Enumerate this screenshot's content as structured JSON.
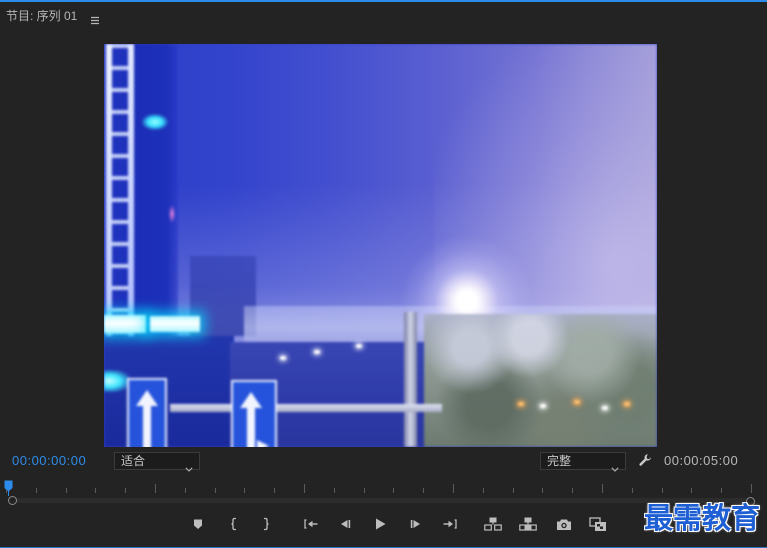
{
  "panel": {
    "title": "节目: 序列 01",
    "menu_icon": "hamburger-menu-icon"
  },
  "colors": {
    "accent": "#2d8ceb",
    "background": "#232323",
    "icon": "#bdbdbd",
    "watermark": "#1f5fd4"
  },
  "timecode_bar": {
    "current_timecode": "00:00:00:00",
    "zoom_level": {
      "selected": "适合",
      "icon": "chevron-down-icon"
    },
    "playback_resolution": {
      "selected": "完整",
      "icon": "chevron-down-icon"
    },
    "settings_icon": "wrench-icon",
    "duration_timecode": "00:00:05:00"
  },
  "timeline": {
    "playhead_fraction": 0
  },
  "transport_icons": [
    "marker-icon",
    "mark-in-icon",
    "mark-out-icon",
    "go-to-in-icon",
    "step-back-icon",
    "play-icon",
    "step-forward-icon",
    "go-to-out-icon",
    "insert-icon",
    "overwrite-icon",
    "camera-icon",
    "compare-icon"
  ],
  "watermark": {
    "text": "最需教育"
  }
}
